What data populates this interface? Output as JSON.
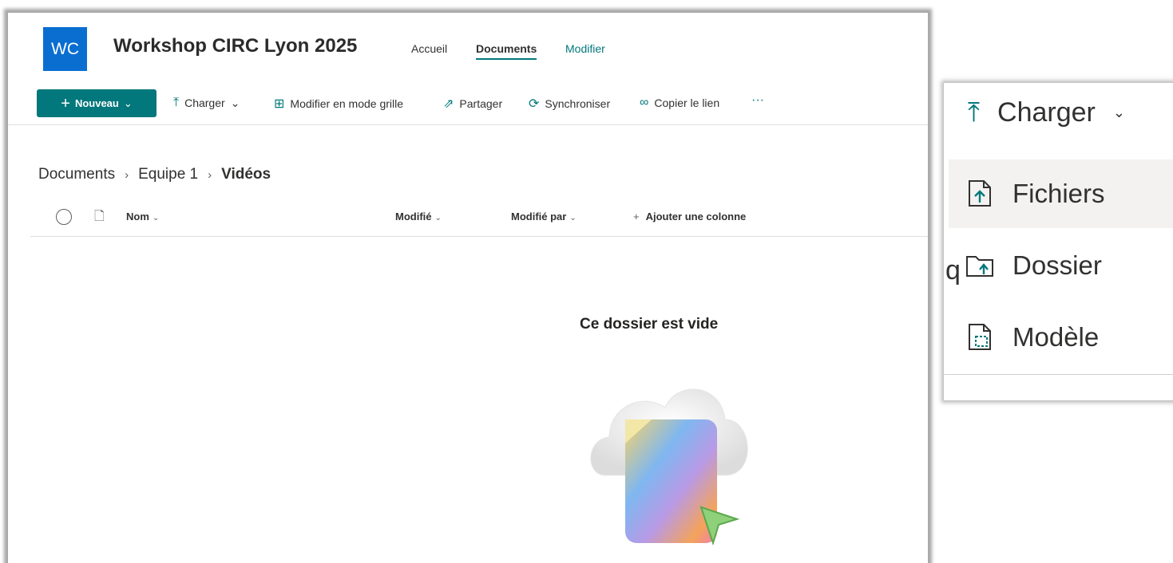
{
  "site": {
    "logo_text": "WC",
    "title": "Workshop CIRC Lyon 2025",
    "nav": {
      "accueil": "Accueil",
      "documents": "Documents",
      "modifier": "Modifier"
    }
  },
  "toolbar": {
    "new_label": "Nouveau",
    "charger": "Charger",
    "grille": "Modifier en mode grille",
    "partager": "Partager",
    "synchroniser": "Synchroniser",
    "copier": "Copier le lien",
    "more": "···"
  },
  "breadcrumb": {
    "root": "Documents",
    "mid": "Equipe 1",
    "current": "Vidéos"
  },
  "columns": {
    "nom": "Nom",
    "modifie": "Modifié",
    "modifie_par": "Modifié par",
    "ajouter": "Ajouter une colonne"
  },
  "empty": {
    "title": "Ce dossier est vide"
  },
  "upload_menu": {
    "header": "Charger",
    "items": [
      {
        "label": "Fichiers"
      },
      {
        "label": "Dossier"
      },
      {
        "label": "Modèle"
      }
    ]
  },
  "colors": {
    "accent": "#03787c",
    "logo": "#0a6ed1"
  }
}
